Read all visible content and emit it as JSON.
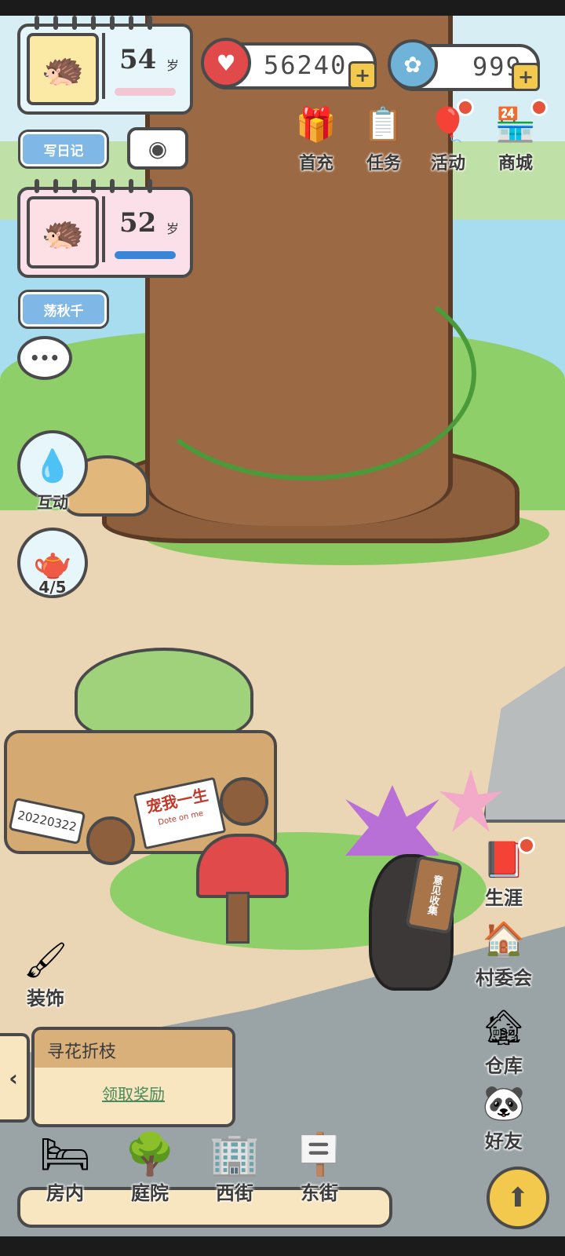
{
  "player1": {
    "age": "54",
    "age_suffix": "岁",
    "avatar_icon": "hedgehog-icon",
    "bar_color": "#f3c6d3"
  },
  "player2": {
    "age": "52",
    "age_suffix": "岁",
    "avatar_icon": "hedgehog-icon",
    "bar_color": "#3a86d6"
  },
  "buttons": {
    "diary": "写日记",
    "swing": "荡秋千"
  },
  "currency": {
    "hearts": "56240",
    "clovers": "999"
  },
  "top_icons": [
    {
      "label": "首充",
      "icon": "gift-icon"
    },
    {
      "label": "任务",
      "icon": "clipboard-icon"
    },
    {
      "label": "活动",
      "icon": "balloon-icon"
    },
    {
      "label": "商城",
      "icon": "shop-icon"
    }
  ],
  "left_actions": {
    "interact": "互动",
    "water": "4/5"
  },
  "right_icons": [
    {
      "label": "生涯",
      "icon": "book-icon"
    },
    {
      "label": "村委会",
      "icon": "house-icon"
    },
    {
      "label": "仓库",
      "icon": "warehouse-icon"
    },
    {
      "label": "好友",
      "icon": "panda-friends-icon"
    }
  ],
  "decorate": {
    "label": "装饰",
    "icon": "paintbrush-icon"
  },
  "quest": {
    "title": "寻花折枝",
    "link": "领取奖励"
  },
  "nav": [
    {
      "label": "房内",
      "icon": "bed-icon"
    },
    {
      "label": "庭院",
      "icon": "garden-icon"
    },
    {
      "label": "西街",
      "icon": "building-icon"
    },
    {
      "label": "东街",
      "icon": "signpost-icon"
    }
  ],
  "scene": {
    "plate": "20220322",
    "car_sign": "宠我一生",
    "car_sign_sub": "Dote on me",
    "bear_sign": "意见收集"
  },
  "colors": {
    "accent_blue": "#7fb7e6",
    "heart_red": "#e04a4a",
    "gold": "#f2c94c"
  }
}
